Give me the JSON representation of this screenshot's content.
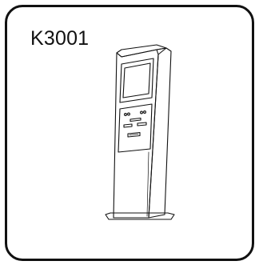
{
  "product": {
    "model": "K3001",
    "illustration_icon": "kiosk-terminal-icon",
    "line_color": "#111111",
    "background_color": "#ffffff"
  }
}
